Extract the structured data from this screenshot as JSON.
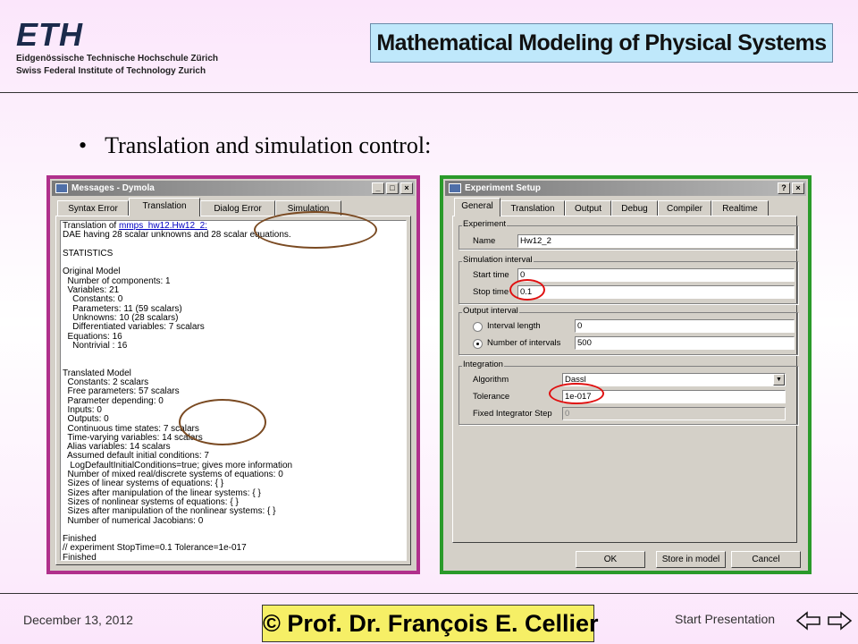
{
  "header": {
    "institution_mark": "ETH",
    "institution_line1": "Eidgenössische Technische Hochschule Zürich",
    "institution_line2": "Swiss Federal Institute of Technology Zurich",
    "course_title": "Mathematical Modeling of Physical Systems"
  },
  "slide": {
    "bullet_symbol": "•",
    "bullet_text": "Translation and simulation control:"
  },
  "messages_window": {
    "title": "Messages - Dymola",
    "title_buttons": [
      "_",
      "□",
      "×"
    ],
    "tabs": [
      "Syntax Error",
      "Translation",
      "Dialog Error",
      "Simulation"
    ],
    "active_tab": "Translation",
    "log_link": "mmps_hw12.Hw12_2:",
    "log_first_line_prefix": "Translation of ",
    "log_lines": [
      "DAE having 28 scalar unknowns and 28 scalar equations.",
      "",
      "STATISTICS",
      "",
      "Original Model",
      "  Number of components: 1",
      "  Variables: 21",
      "    Constants: 0",
      "    Parameters: 11 (59 scalars)",
      "    Unknowns: 10 (28 scalars)",
      "    Differentiated variables: 7 scalars",
      "  Equations: 16",
      "    Nontrivial : 16",
      "",
      "",
      "Translated Model",
      "  Constants: 2 scalars",
      "  Free parameters: 57 scalars",
      "  Parameter depending: 0",
      "  Inputs: 0",
      "  Outputs: 0",
      "  Continuous time states: 7 scalars",
      "  Time-varying variables: 14 scalars",
      "  Alias variables: 14 scalars",
      "  Assumed default initial conditions: 7",
      "   LogDefaultInitialConditions=true; gives more information",
      "  Number of mixed real/discrete systems of equations: 0",
      "  Sizes of linear systems of equations: { }",
      "  Sizes after manipulation of the linear systems: { }",
      "  Sizes of nonlinear systems of equations: { }",
      "  Sizes after manipulation of the nonlinear systems: { }",
      "  Number of numerical Jacobians: 0",
      "",
      "Finished",
      "// experiment StopTime=0.1 Tolerance=1e-017",
      "Finished"
    ]
  },
  "experiment_window": {
    "title": "Experiment Setup",
    "title_buttons": [
      "?",
      "×"
    ],
    "tabs": [
      "General",
      "Translation",
      "Output",
      "Debug",
      "Compiler",
      "Realtime"
    ],
    "active_tab": "General",
    "group_experiment": "Experiment",
    "name_label": "Name",
    "name_value": "Hw12_2",
    "group_simulation": "Simulation interval",
    "start_label": "Start time",
    "start_value": "0",
    "stop_label": "Stop time",
    "stop_value": "0.1",
    "group_output": "Output interval",
    "interval_length_label": "Interval length",
    "interval_length_value": "0",
    "num_intervals_label": "Number of intervals",
    "num_intervals_value": "500",
    "selected_output_option": "Number of intervals",
    "group_integration": "Integration",
    "algorithm_label": "Algorithm",
    "algorithm_value": "Dassl",
    "tolerance_label": "Tolerance",
    "tolerance_value": "1e-017",
    "fixed_step_label": "Fixed Integrator Step",
    "fixed_step_value": "0",
    "ok_label": "OK",
    "store_label": "Store in model",
    "cancel_label": "Cancel"
  },
  "footer": {
    "date": "December 13, 2012",
    "author": "© Prof. Dr. François E. Cellier",
    "start_link": "Start Presentation"
  },
  "colors": {
    "title_box": "#bfe8fb",
    "author_box": "#f6ef66",
    "messages_frame": "#b0308c",
    "experiment_frame": "#2a9a2a",
    "annotation_brown": "#7a4a22",
    "annotation_red": "#e01010"
  }
}
